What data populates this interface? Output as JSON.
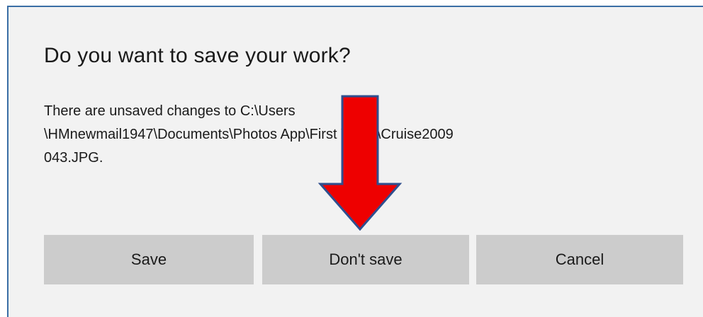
{
  "dialog": {
    "title": "Do you want to save your work?",
    "message": "There are unsaved changes to C:\\Users\n\\HMnewmail1947\\Documents\\Photos App\\First Video\\Cruise2009\n043.JPG."
  },
  "buttons": {
    "save_label": "Save",
    "dont_save_label": "Don't save",
    "cancel_label": "Cancel"
  },
  "annotation": {
    "icon": "down-arrow-icon",
    "fill_color": "#ee0000",
    "stroke_color": "#2f4f8f"
  },
  "colors": {
    "dialog_background": "#f2f2f2",
    "button_background": "#cccccc",
    "border_accent": "#3a6ea5"
  }
}
